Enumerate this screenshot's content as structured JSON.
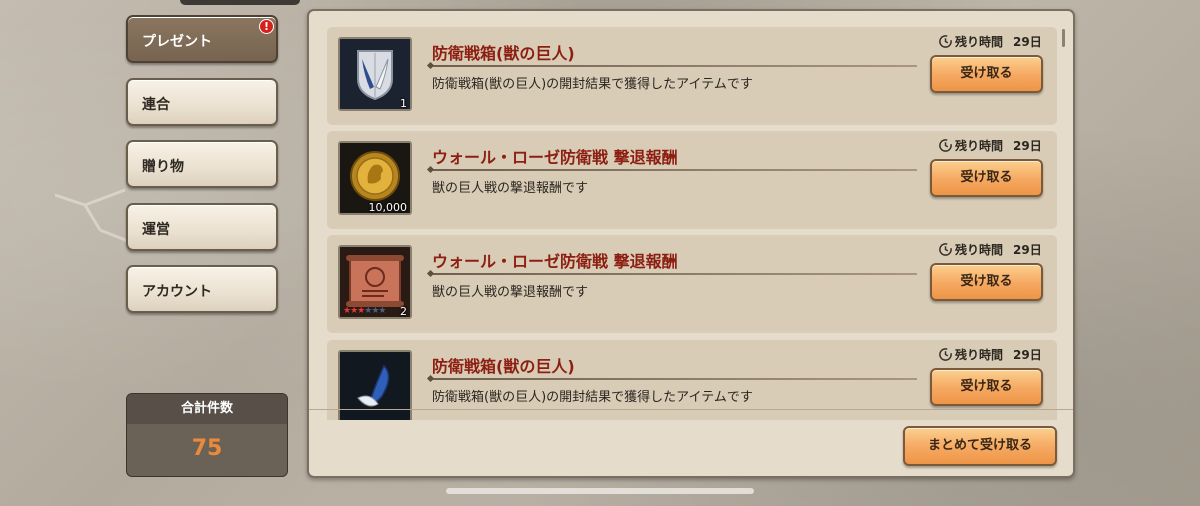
{
  "sidebar": {
    "items": [
      {
        "label": "プレゼント",
        "active": true,
        "badge": "!"
      },
      {
        "label": "連合"
      },
      {
        "label": "贈り物"
      },
      {
        "label": "運営"
      },
      {
        "label": "アカウント"
      }
    ]
  },
  "total": {
    "label": "合計件数",
    "value": "75"
  },
  "presents": [
    {
      "icon": "scout-emblem-icon",
      "quantity": "1",
      "title": "防衛戦箱(獣の巨人)",
      "description": "防衛戦箱(獣の巨人)の開封結果で獲得したアイテムです",
      "timer_label": "残り時間",
      "timer_value": "29日",
      "button_label": "受け取る"
    },
    {
      "icon": "gold-coin-icon",
      "quantity": "10,000",
      "title": "ウォール・ローゼ防衛戦 撃退報酬",
      "description": "獣の巨人戦の撃退報酬です",
      "timer_label": "残り時間",
      "timer_value": "29日",
      "button_label": "受け取る"
    },
    {
      "icon": "scroll-icon",
      "quantity": "2",
      "stars": 3,
      "stars_max": 6,
      "title": "ウォール・ローゼ防衛戦 撃退報酬",
      "description": "獣の巨人戦の撃退報酬です",
      "timer_label": "残り時間",
      "timer_value": "29日",
      "button_label": "受け取る"
    },
    {
      "icon": "blue-feather-icon",
      "quantity": "",
      "title": "防衛戦箱(獣の巨人)",
      "description": "防衛戦箱(獣の巨人)の開封結果で獲得したアイテムです",
      "timer_label": "残り時間",
      "timer_value": "29日",
      "button_label": "受け取る"
    }
  ],
  "bulk_button_label": "まとめて受け取る",
  "colors": {
    "title_red": "#8c1f12",
    "button_orange": "#f5a861",
    "count_orange": "#ec8a3a",
    "active_tab": "#7f6c57"
  }
}
